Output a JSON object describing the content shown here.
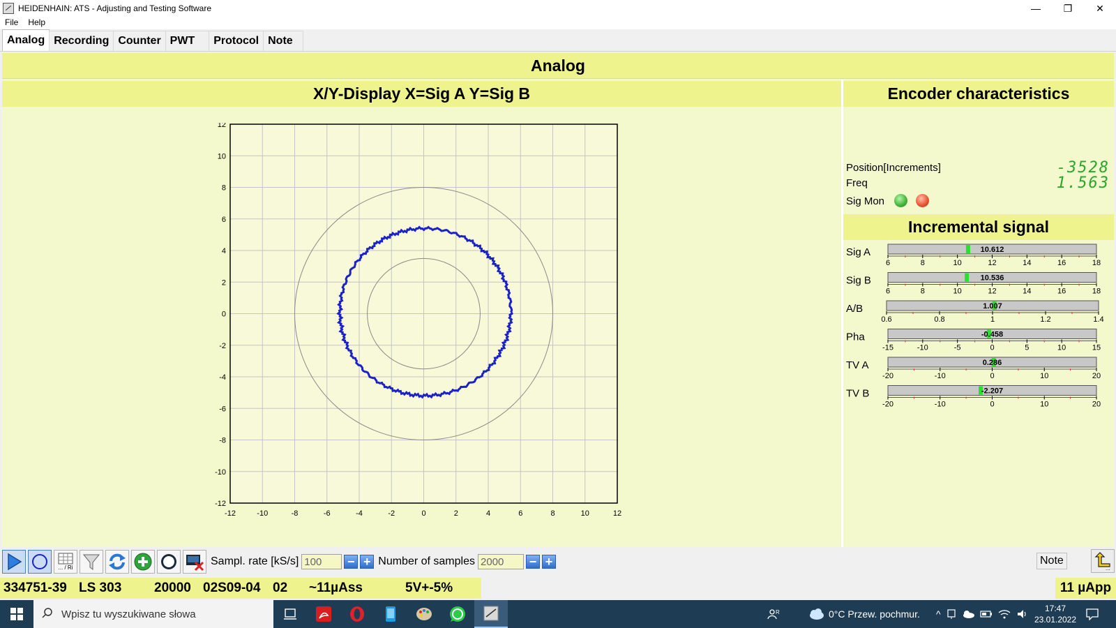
{
  "window": {
    "title": "HEIDENHAIN: ATS - Adjusting and Testing Software",
    "controls": [
      "—",
      "❐",
      "✕"
    ]
  },
  "menu": [
    "File",
    "Help"
  ],
  "tabs": [
    "Analog",
    "Recording",
    "Counter",
    "PWT",
    "Protocol",
    "Note"
  ],
  "main": {
    "title": "Analog",
    "xy_title": "X/Y-Display X=Sig A Y=Sig B",
    "enc_title": "Encoder characteristics",
    "inc_title": "Incremental signal"
  },
  "xy_plot": {
    "x_ticks": [
      "-12",
      "-10",
      "-8",
      "-6",
      "-4",
      "-2",
      "0",
      "2",
      "4",
      "6",
      "8",
      "10",
      "12"
    ],
    "y_ticks": [
      "12",
      "10",
      "8",
      "6",
      "4",
      "2",
      "0",
      "-2",
      "-4",
      "-6",
      "-8",
      "-10",
      "-12"
    ],
    "range": [
      -12,
      12
    ],
    "reference_circle_radii": [
      3.5,
      8
    ],
    "signal_center": [
      0.1,
      0.1
    ],
    "signal_radius": 5.3,
    "signal_color": "#1a22c8",
    "grid": true
  },
  "encoder": {
    "position_label": "Position[Increments]",
    "position_value": "-3528",
    "freq_label": "Freq",
    "freq_value": "1.563",
    "sigmon_label": "Sig Mon",
    "sigmon_leds": [
      "green",
      "red"
    ]
  },
  "gauges": [
    {
      "label": "Sig A",
      "value_text": "10.612",
      "value": 10.612,
      "min": 6,
      "max": 18,
      "ticks": [
        "6",
        "8",
        "10",
        "12",
        "14",
        "16",
        "18"
      ]
    },
    {
      "label": "Sig B",
      "value_text": "10.536",
      "value": 10.536,
      "min": 6,
      "max": 18,
      "ticks": [
        "6",
        "8",
        "10",
        "12",
        "14",
        "16",
        "18"
      ]
    },
    {
      "label": "A/B",
      "value_text": "1.007",
      "value": 1.007,
      "min": 0.6,
      "max": 1.4,
      "ticks": [
        "0.6",
        "0.8",
        "1",
        "1.2",
        "1.4"
      ]
    },
    {
      "label": "Pha",
      "value_text": "-0.458",
      "value": -0.458,
      "min": -15,
      "max": 15,
      "ticks": [
        "-15",
        "-10",
        "-5",
        "0",
        "5",
        "10",
        "15"
      ]
    },
    {
      "label": "TV A",
      "value_text": "0.286",
      "value": 0.286,
      "min": -20,
      "max": 20,
      "ticks": [
        "-20",
        "-10",
        "0",
        "10",
        "20"
      ]
    },
    {
      "label": "TV B",
      "value_text": "-2.207",
      "value": -2.207,
      "min": -20,
      "max": 20,
      "ticks": [
        "-20",
        "-10",
        "0",
        "10",
        "20"
      ]
    }
  ],
  "toolbar": {
    "sampl_rate_label": "Sampl. rate [kS/s]",
    "sampl_rate_value": "100",
    "num_samples_label": "Number of samples",
    "num_samples_value": "2000",
    "minus": "−",
    "plus": "+",
    "note_label": "Note",
    "grid_btn_text": "... / Ri"
  },
  "status": {
    "id": "334751-39",
    "model": "LS 303",
    "lines": "20000",
    "code": "02S09-04",
    "num": "02",
    "signal": "~11µAss",
    "voltage": "5V+-5%",
    "amplitude": "11 µApp"
  },
  "taskbar": {
    "search_placeholder": "Wpisz tu wyszukiwane słowa",
    "weather": "0°C  Przew. pochmur.",
    "time": "17:47",
    "date": "23.01.2022"
  }
}
